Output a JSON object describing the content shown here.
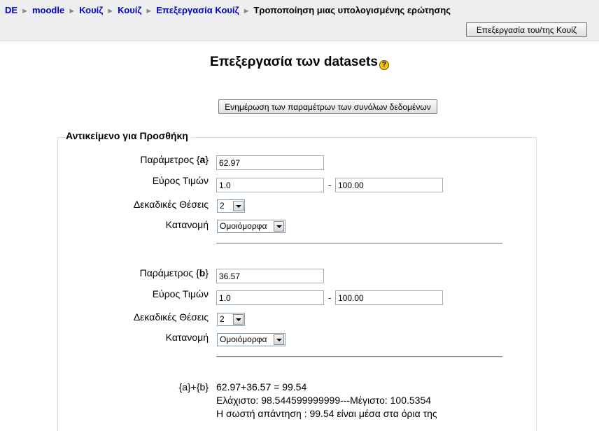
{
  "breadcrumb": {
    "items": [
      "DE",
      "moodle",
      "Κουίζ",
      "Κουίζ",
      "Επεξεργασία Κουίζ"
    ],
    "current": "Τροποποίηση μιας υπολογισμένης ερώτησης",
    "separator": "►"
  },
  "header": {
    "edit_quiz_button": "Επεξεργασία του/της Κουίζ"
  },
  "page": {
    "title": "Επεξεργασία των datasets",
    "help_icon": "?",
    "update_button": "Ενημέρωση των παραμέτρων των συνόλων δεδομένων"
  },
  "fieldset": {
    "legend": "Αντικείμενο για Προσθήκη",
    "params": [
      {
        "label_prefix": "Παράμετρος {",
        "name": "a",
        "label_suffix": "}",
        "value": "62.97",
        "range_label": "Εύρος Τιμών",
        "range_min": "1.0",
        "range_sep": "-",
        "range_max": "100.00",
        "decimals_label": "Δεκαδικές Θέσεις",
        "decimals_value": "2",
        "distribution_label": "Κατανομή",
        "distribution_value": "Ομοιόμορφα"
      },
      {
        "label_prefix": "Παράμετρος {",
        "name": "b",
        "label_suffix": "}",
        "value": "36.57",
        "range_label": "Εύρος Τιμών",
        "range_min": "1.0",
        "range_sep": "-",
        "range_max": "100.00",
        "decimals_label": "Δεκαδικές Θέσεις",
        "decimals_value": "2",
        "distribution_label": "Κατανομή",
        "distribution_value": "Ομοιόμορφα"
      }
    ],
    "calculation": {
      "formula": "{a}+{b}",
      "result_line": "62.97+36.57 = 99.54",
      "minmax_line": "Ελάχιστο: 98.544599999999---Μέγιστο: 100.5354",
      "answer_line": "Η σωστή απάντηση : 99.54 είναι μέσα στα όρια της"
    }
  }
}
